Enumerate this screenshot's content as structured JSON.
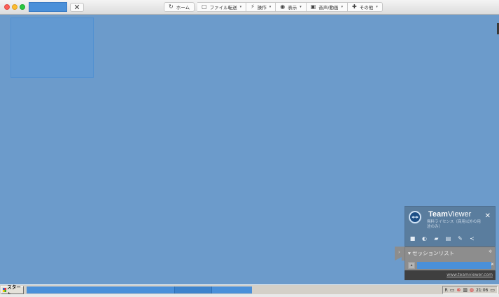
{
  "window": {
    "toolbar": [
      {
        "name": "home",
        "icon": "↻",
        "label": "ホーム",
        "caret": ""
      },
      {
        "name": "file-transfer",
        "icon": "▢",
        "label": "ファイル転送",
        "caret": "▾"
      },
      {
        "name": "actions",
        "icon": "⚡",
        "label": "操作",
        "caret": "▾"
      },
      {
        "name": "view",
        "icon": "◉",
        "label": "表示",
        "caret": "▾"
      },
      {
        "name": "audio-video",
        "icon": "▣",
        "label": "音声/動画",
        "caret": "▾"
      },
      {
        "name": "extras",
        "icon": "✚",
        "label": "その他",
        "caret": "▾"
      }
    ]
  },
  "teamviewer": {
    "brand_bold": "Team",
    "brand_rest": "Viewer",
    "subtitle": "無料ライセンス（商用以外の用途のみ）",
    "icons": [
      "camera-icon",
      "headset-icon",
      "chat-icon",
      "file-icon",
      "tools-icon",
      "share-icon"
    ],
    "session_title": "▾ セッションリスト",
    "footer_link": "www.teamviewer.com"
  },
  "taskbar": {
    "start_label": "スタート",
    "clock": "21:06",
    "tray_letter": "R"
  },
  "colors": {
    "desktop": "#6c9bcb",
    "accent": "#4a90d9",
    "tv_head": "#5a7d9e"
  }
}
